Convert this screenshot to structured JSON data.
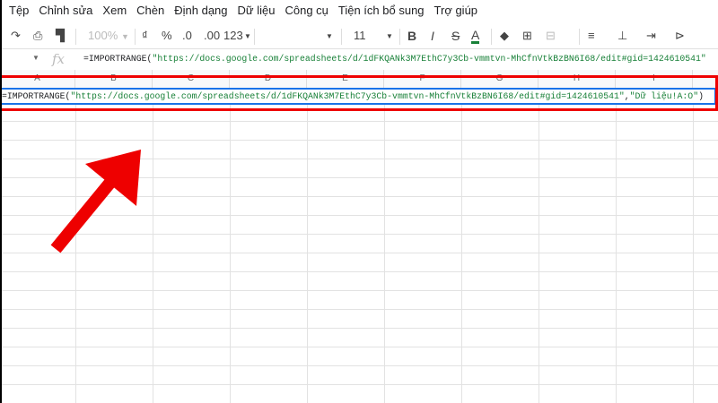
{
  "menu": [
    "Tệp",
    "Chỉnh sửa",
    "Xem",
    "Chèn",
    "Định dạng",
    "Dữ liệu",
    "Công cụ",
    "Tiện ích bổ sung",
    "Trợ giúp"
  ],
  "toolbar": {
    "zoom": "100%",
    "currency": "₫",
    "percent": "%",
    "dec_less": ".0",
    "dec_more": ".00",
    "format": "123",
    "font_size": "11",
    "bold": "B",
    "italic": "I",
    "strike": "S",
    "text_color": "A",
    "text_color_value": "#188038"
  },
  "formula_bar": {
    "fx": "fx",
    "prefix": "=IMPORTRANGE(",
    "url": "\"https://docs.google.com/spreadsheets/d/1dFKQANk3M7EthC7y3Cb-vmmtvn-MhCfnVtkBzBN6I68/edit#gid=1424610541\""
  },
  "columns": [
    "A",
    "B",
    "C",
    "D",
    "E",
    "F",
    "G",
    "H",
    "I"
  ],
  "cell": {
    "prefix": "=IMPORTRANGE(",
    "url": "\"https://docs.google.com/spreadsheets/d/1dFKQANk3M7EthC7y3Cb-vmmtvn-MhCfnVtkBzBN6I68/edit#gid=1424610541\"",
    "sep": ",",
    "range": "\"Dữ liệu!A:O\"",
    "close": ")"
  },
  "colors": {
    "highlight": "#e00000",
    "selection": "#1a73e8"
  }
}
